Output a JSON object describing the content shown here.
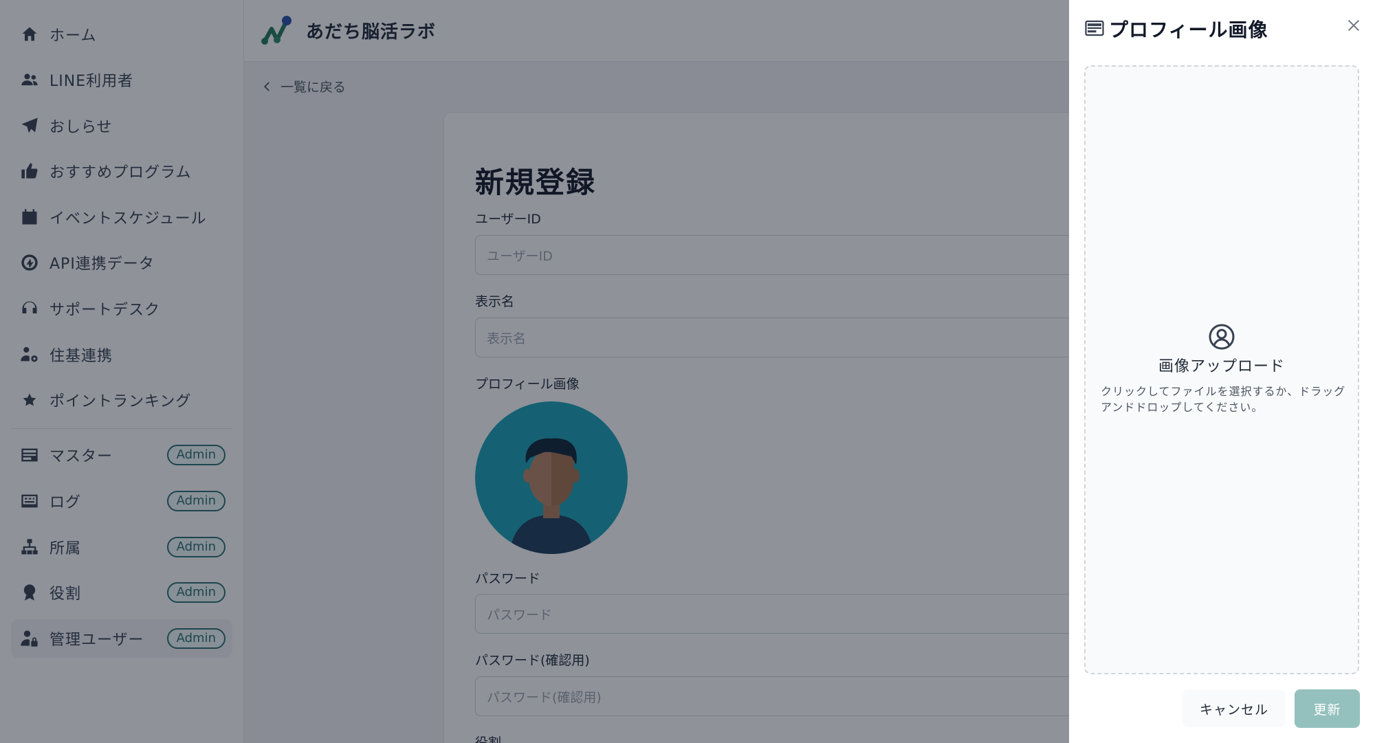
{
  "app": {
    "title": "あだち脳活ラボ",
    "brand_colors": [
      "#1f7a5c",
      "#2a4fa8"
    ]
  },
  "sidebar": {
    "items": [
      {
        "label": "ホーム",
        "icon": "home-icon"
      },
      {
        "label": "LINE利用者",
        "icon": "users-icon"
      },
      {
        "label": "おしらせ",
        "icon": "paper-plane-icon"
      },
      {
        "label": "おすすめプログラム",
        "icon": "thumbs-up-icon"
      },
      {
        "label": "イベントスケジュール",
        "icon": "calendar-icon"
      },
      {
        "label": "API連携データ",
        "icon": "api-icon"
      },
      {
        "label": "サポートデスク",
        "icon": "headset-icon"
      },
      {
        "label": "住基連携",
        "icon": "user-gear-icon"
      },
      {
        "label": "ポイントランキング",
        "icon": "star-icon"
      }
    ],
    "admin_items": [
      {
        "label": "マスター",
        "icon": "master-icon",
        "badge": "Admin"
      },
      {
        "label": "ログ",
        "icon": "log-icon",
        "badge": "Admin"
      },
      {
        "label": "所属",
        "icon": "sitemap-icon",
        "badge": "Admin"
      },
      {
        "label": "役割",
        "icon": "award-icon",
        "badge": "Admin"
      },
      {
        "label": "管理ユーザー",
        "icon": "user-lock-icon",
        "badge": "Admin"
      }
    ]
  },
  "main": {
    "back_label": "一覧に戻る",
    "form": {
      "title": "新規登録",
      "user_id_label": "ユーザーID",
      "user_id_placeholder": "ユーザーID",
      "display_name_label": "表示名",
      "display_name_placeholder": "表示名",
      "profile_image_label": "プロフィール画像",
      "password_label": "パスワード",
      "password_placeholder": "パスワード",
      "password_confirm_label": "パスワード(確認用)",
      "password_confirm_placeholder": "パスワード(確認用)",
      "role_label": "役割"
    }
  },
  "drawer": {
    "title": "プロフィール画像",
    "upload_title": "画像アップロード",
    "upload_desc": "クリックしてファイルを選択するか、ドラッグアンドドロップしてください。",
    "cancel_label": "キャンセル",
    "update_label": "更新"
  }
}
